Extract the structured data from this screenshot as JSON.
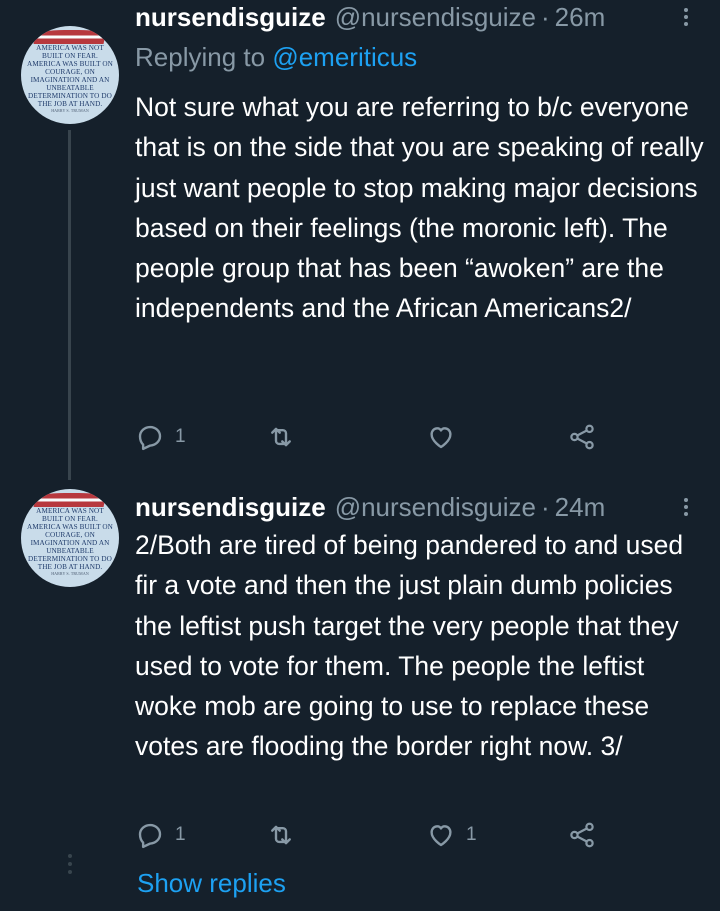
{
  "tweets": [
    {
      "display_name": "nursendisguize",
      "handle": "@nursendisguize",
      "separator": "·",
      "time": "26m",
      "replying_to_label": "Replying to",
      "replying_to_handle": "@emeriticus",
      "text": "Not sure what you are referring to b/c everyone that is on the side that you are speaking of really just want people to stop making major decisions based on their feelings (the moronic left). The people group that has been “awoken” are the independents and the African Americans2/",
      "avatar_quote": "AMERICA WAS NOT BUILT ON FEAR. AMERICA WAS BUILT ON COURAGE, ON IMAGINATION AND AN UNBEATABLE DETERMINATION TO DO THE JOB AT HAND.",
      "avatar_attribution": "HARRY S. TRUMAN",
      "replies": "1",
      "retweets": "",
      "likes": "",
      "icons": {
        "reply": "reply-icon",
        "retweet": "retweet-icon",
        "like": "heart-icon",
        "share": "share-icon",
        "more": "more-icon"
      }
    },
    {
      "display_name": "nursendisguize",
      "handle": "@nursendisguize",
      "separator": "·",
      "time": "24m",
      "text": "2/Both are tired of being pandered to and used fir a vote and then the just plain dumb policies the leftist push target the very people that they used to vote for them. The people the leftist woke mob are going to use to replace these votes are flooding the border right now. 3/",
      "avatar_quote": "AMERICA WAS NOT BUILT ON FEAR. AMERICA WAS BUILT ON COURAGE, ON IMAGINATION AND AN UNBEATABLE DETERMINATION TO DO THE JOB AT HAND.",
      "avatar_attribution": "HARRY S. TRUMAN",
      "replies": "1",
      "retweets": "",
      "likes": "1",
      "show_replies": "Show replies"
    }
  ],
  "colors": {
    "background": "#15202b",
    "text": "#ffffff",
    "secondary": "#8899a6",
    "accent": "#1da1f2",
    "thread_line": "#38444d"
  }
}
